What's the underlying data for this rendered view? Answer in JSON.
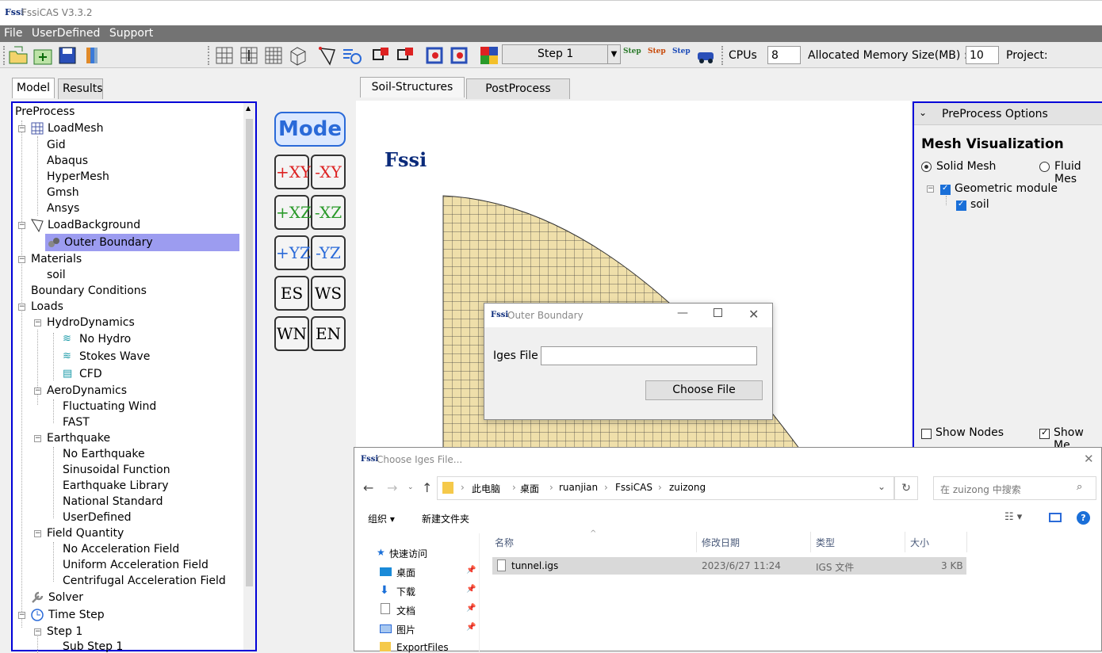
{
  "app": {
    "title": "FssiCAS V3.3.2",
    "logo": "Fssi"
  },
  "menu": [
    "File",
    "UserDefined",
    "Support"
  ],
  "toolbar": {
    "step": "Step 1",
    "step_btn": "Step",
    "cpus_label": "CPUs",
    "cpus_value": "8",
    "mem_label": "Allocated Memory Size(MB) :",
    "mem_value": "10",
    "project_label": "Project:"
  },
  "left_tabs": [
    "Model",
    "Results"
  ],
  "tree": {
    "root": "PreProcess",
    "loadmesh": "LoadMesh",
    "gid": "Gid",
    "abaqus": "Abaqus",
    "hypermesh": "HyperMesh",
    "gmsh": "Gmsh",
    "ansys": "Ansys",
    "loadbackground": "LoadBackground",
    "outer_boundary": "Outer Boundary",
    "materials": "Materials",
    "soil": "soil",
    "boundary_conditions": "Boundary Conditions",
    "loads": "Loads",
    "hydro": "HydroDynamics",
    "no_hydro": "No Hydro",
    "stokes": "Stokes Wave",
    "cfd": "CFD",
    "aero": "AeroDynamics",
    "fluct": "Fluctuating Wind",
    "fast": "FAST",
    "earthquake": "Earthquake",
    "no_eq": "No Earthquake",
    "sin": "Sinusoidal Function",
    "eqlib": "Earthquake Library",
    "natstd": "National Standard",
    "userdef": "UserDefined",
    "field": "Field Quantity",
    "noacc": "No Acceleration Field",
    "uniacc": "Uniform Acceleration Field",
    "cenacc": "Centrifugal Acceleration Field",
    "solver": "Solver",
    "timestep": "Time Step",
    "step1": "Step 1",
    "substep1": "Sub Step 1"
  },
  "view_buttons": {
    "mode": "Mode",
    "xy_p": "+XY",
    "xy_m": "-XY",
    "xz_p": "+XZ",
    "xz_m": "-XZ",
    "yz_p": "+YZ",
    "yz_m": "-YZ",
    "es": "ES",
    "ws": "WS",
    "wn": "WN",
    "en": "EN"
  },
  "center_tabs": [
    "Soil-Structures",
    "PostProcess"
  ],
  "viewport_logo": "Fssi",
  "right_panel": {
    "header": "PreProcess Options",
    "section": "Mesh Visualization",
    "radio_solid": "Solid Mesh",
    "radio_fluid": "Fluid Mes",
    "geo": "Geometric module",
    "soil": "soil",
    "show_nodes": "Show Nodes",
    "show_mesh": "Show Me"
  },
  "outer_dialog": {
    "title": "Outer Boundary",
    "label": "Iges File",
    "value": "",
    "button": "Choose File"
  },
  "file_dialog": {
    "title": "Choose Iges File...",
    "path": [
      "此电脑",
      "桌面",
      "ruanjian",
      "FssiCAS",
      "zuizong"
    ],
    "search_placeholder": "在 zuizong 中搜索",
    "organize": "组织 ▾",
    "new_folder": "新建文件夹",
    "nav": [
      "快速访问",
      "桌面",
      "下载",
      "文档",
      "图片",
      "ExportFiles"
    ],
    "columns": [
      "名称",
      "修改日期",
      "类型",
      "大小"
    ],
    "files": [
      {
        "name": "tunnel.igs",
        "date": "2023/6/27 11:24",
        "type": "IGS 文件",
        "size": "3 KB"
      }
    ]
  }
}
